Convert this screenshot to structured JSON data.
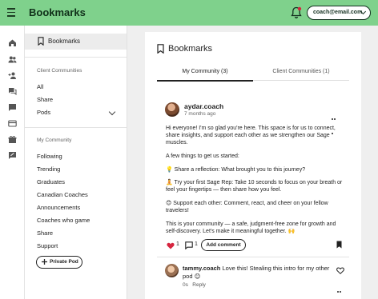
{
  "app": {
    "title": "Bookmarks",
    "account_email": "coach@email.com"
  },
  "rail": {
    "icons": [
      "home-icon",
      "people-icon",
      "add-person-icon",
      "forum-icon",
      "chat-icon",
      "card-icon",
      "gift-icon",
      "feedback-icon"
    ]
  },
  "sidebar": {
    "top_item": "Bookmarks",
    "client_communities": {
      "heading": "Client Communities",
      "items": [
        "All",
        "Share",
        "Pods"
      ]
    },
    "my_community": {
      "heading": "My Community",
      "items": [
        "Following",
        "Trending",
        "Graduates",
        "Canadian Coaches",
        "Announcements",
        "Coaches who game",
        "Share",
        "Support"
      ]
    },
    "private_pod_button": "Private Pod"
  },
  "main": {
    "title": "Bookmarks",
    "tabs": [
      "My Community (3)",
      "Client Communities (1)"
    ],
    "active_tab": 0,
    "post": {
      "author": "aydar.coach",
      "time": "7 months ago",
      "paragraphs": [
        "Hi everyone! I'm so glad you're here. This space is for us to connect, share insights, and support each other as we strengthen our Sage muscles.",
        "A few things to get us started:",
        "💡 Share a reflection: What brought you to this journey?",
        "🧘 Try your first Sage Rep: Take 10 seconds to focus on your breath or feel your fingertips — then share how you feel.",
        "😊 Support each other: Comment, react, and cheer on your fellow travelers!",
        "This is your community — a safe, judgment-free zone for growth and self-discovery. Let's make it meaningful together. 🙌"
      ],
      "likes": "1",
      "comments": "1",
      "add_comment_label": "Add comment"
    },
    "comment": {
      "author": "tammy.coach",
      "text": "Love this! Stealing this intro for my other pod 😊",
      "time": "0s",
      "reply_label": "Reply"
    }
  },
  "colors": {
    "topbar": "#7fd18c",
    "heart": "#d6253f"
  }
}
